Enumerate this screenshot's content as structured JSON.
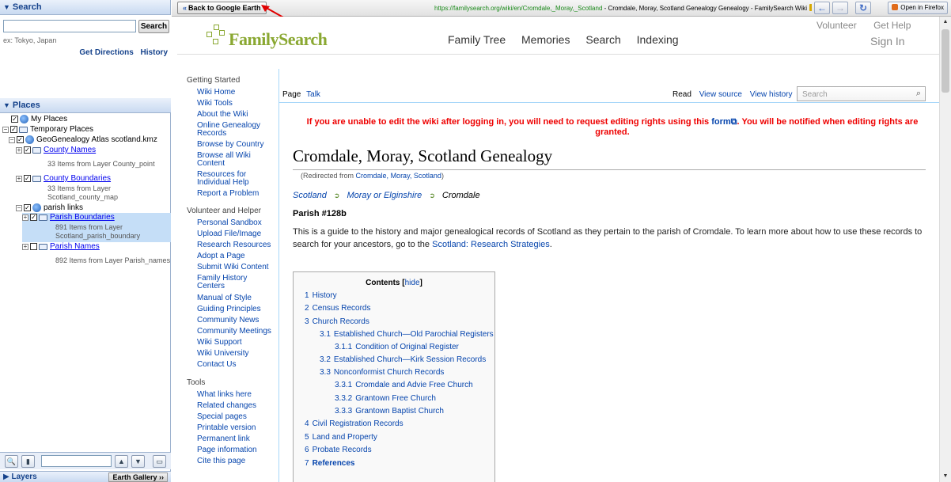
{
  "ge": {
    "search_header": "Search",
    "search_value": "",
    "search_button": "Search",
    "search_hint": "ex: Tokyo, Japan",
    "get_directions": "Get Directions",
    "history": "History",
    "places_header": "Places",
    "tree": {
      "my_places": "My Places",
      "temporary_places": "Temporary Places",
      "atlas": "GeoGenealogy Atlas scotland.kmz",
      "county_names": "County Names",
      "county_names_sub": "33 Items from Layer County_point",
      "county_boundaries": "County Boundaries",
      "county_boundaries_sub1": "33 Items from Layer",
      "county_boundaries_sub2": "Scotland_county_map",
      "parish_links": "parish links",
      "parish_boundaries": "Parish Boundaries",
      "parish_boundaries_sub1": "891 Items from Layer",
      "parish_boundaries_sub2": "Scotland_parish_boundary",
      "parish_names": "Parish Names",
      "parish_names_sub": "892 Items from Layer Parish_names"
    },
    "layers": "Layers",
    "earth_gallery": "Earth Gallery"
  },
  "browser": {
    "back_to_ge": "Back to Google Earth",
    "url": "https://familysearch.org/wiki/en/Cromdale,_Moray,_Scotland",
    "title_sep": " - ",
    "page_title": "Cromdale, Moray, Scotland Genealogy Genealogy - FamilySearch Wiki",
    "open_in_firefox": "Open in Firefox"
  },
  "site": {
    "logo": "FamilySearch",
    "nav": [
      "Family Tree",
      "Memories",
      "Search",
      "Indexing"
    ],
    "volunteer": "Volunteer",
    "get_help": "Get Help",
    "sign_in": "Sign In"
  },
  "wiki_nav": {
    "getting_started": "Getting Started",
    "gs_items": [
      "Wiki Home",
      "Wiki Tools",
      "About the Wiki",
      "Online Genealogy Records",
      "Browse by Country",
      "Browse all Wiki Content",
      "Resources for Individual Help",
      "Report a Problem"
    ],
    "volunteer": "Volunteer and Helper",
    "v_items": [
      "Personal Sandbox",
      "Upload File/Image",
      "Research Resources",
      "Adopt a Page",
      "Submit Wiki Content",
      "Family History Centers",
      "Manual of Style",
      "Guiding Principles",
      "Community News",
      "Community Meetings",
      "Wiki Support",
      "Wiki University",
      "Contact Us"
    ],
    "tools": "Tools",
    "t_items": [
      "What links here",
      "Related changes",
      "Special pages",
      "Printable version",
      "Permanent link",
      "Page information",
      "Cite this page"
    ]
  },
  "tabs": {
    "page": "Page",
    "talk": "Talk",
    "read": "Read",
    "view_source": "View source",
    "view_history": "View history",
    "search_placeholder": "Search"
  },
  "article": {
    "notice_pre": "If you are unable to edit the wiki after logging in, you will need to request editing rights using this",
    "notice_link": "form",
    "notice_post": ". You will be notified when editing rights are granted.",
    "title": "Cromdale, Moray, Scotland Genealogy",
    "redirect_pre": "(Redirected from",
    "redirect_link": "Cromdale, Moray, Scotland",
    "redirect_post": ")",
    "crumbs": [
      "Scotland",
      "Moray or Elginshire",
      "Cromdale"
    ],
    "parish": "Parish #128b",
    "intro": "This is a guide to the history and major genealogical records of Scotland as they pertain to the parish of Cromdale. To learn more about how to use these records to search for your ancestors, go to the",
    "intro_link": "Scotland: Research Strategies",
    "intro_end": "."
  },
  "toc": {
    "title": "Contents",
    "hide": "hide",
    "items": [
      {
        "num": "1",
        "text": "History"
      },
      {
        "num": "2",
        "text": "Census Records"
      },
      {
        "num": "3",
        "text": "Church Records"
      },
      {
        "num": "3.1",
        "text": "Established Church—Old Parochial Registers"
      },
      {
        "num": "3.1.1",
        "text": "Condition of Original Register"
      },
      {
        "num": "3.2",
        "text": "Established Church—Kirk Session Records"
      },
      {
        "num": "3.3",
        "text": "Nonconformist Church Records"
      },
      {
        "num": "3.3.1",
        "text": "Cromdale and Advie Free Church"
      },
      {
        "num": "3.3.2",
        "text": "Grantown Free Church"
      },
      {
        "num": "3.3.3",
        "text": "Grantown Baptist Church"
      },
      {
        "num": "4",
        "text": "Civil Registration Records"
      },
      {
        "num": "5",
        "text": "Land and Property"
      },
      {
        "num": "6",
        "text": "Probate Records"
      },
      {
        "num": "7",
        "text": "References"
      }
    ]
  }
}
